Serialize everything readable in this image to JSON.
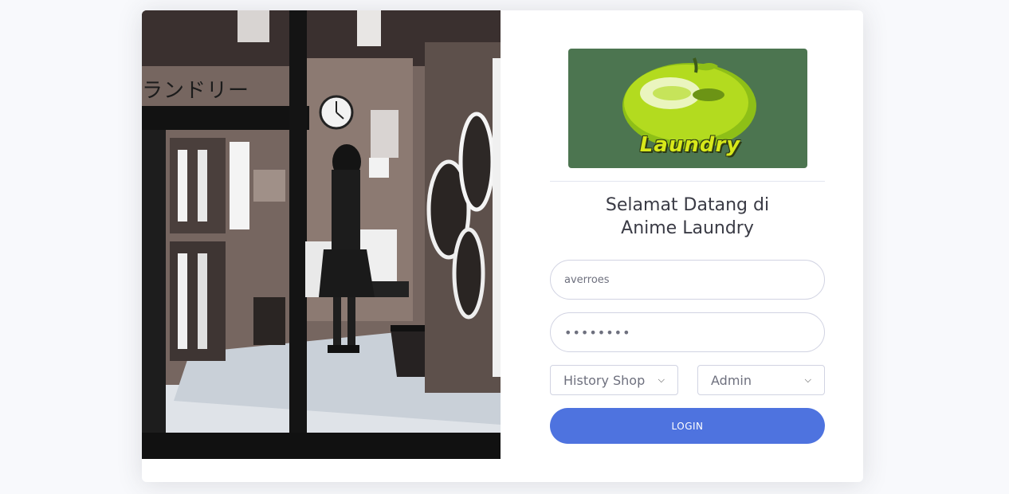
{
  "hero": {
    "caption": "ランドリー",
    "image_name": "anime laundromat illustration"
  },
  "logo": {
    "word": "Laundry",
    "background": "#4c7550",
    "fruit_color": "#a8d11c"
  },
  "welcome": {
    "line1": "Selamat Datang di",
    "line2": "Anime Laundry"
  },
  "form": {
    "username_value": "averroes",
    "password_mask": "••••••••",
    "shop_select": {
      "selected": "History Shop"
    },
    "role_select": {
      "selected": "Admin"
    },
    "login_label": "LOGIN"
  },
  "colors": {
    "primary": "#4e73df",
    "page_bg": "#f8f9fc",
    "text": "#3a3b45"
  }
}
